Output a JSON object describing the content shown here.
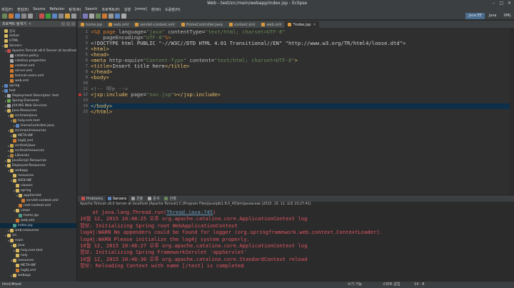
{
  "window": {
    "title": "Web - test/src/main/webapp/index.jsp - Eclipse"
  },
  "menu": [
    "파일(F)",
    "편집(E)",
    "Source",
    "Refactor",
    "탐색(N)",
    "Search",
    "프로젝트(P)",
    "실행",
    "[mme]",
    "창(W)",
    "도움말(H)"
  ],
  "perspectives": [
    "Java EE",
    "Java",
    "XML"
  ],
  "explorer": {
    "title": "프로젝트 탐색기",
    "items": [
      {
        "label": "장식",
        "depth": 0,
        "twisty": "",
        "kind": "folder"
      },
      {
        "label": "action",
        "depth": 0,
        "twisty": "",
        "kind": "folder"
      },
      {
        "label": "HTML",
        "depth": 0,
        "twisty": "",
        "kind": "folder"
      },
      {
        "label": "Servers",
        "depth": 0,
        "twisty": "▾",
        "kind": "folder"
      },
      {
        "label": "Apache Tomcat v8.0 Server at localhost",
        "depth": 1,
        "twisty": "▾",
        "kind": "server"
      },
      {
        "label": "catalina.policy",
        "depth": 2,
        "twisty": "",
        "kind": "file"
      },
      {
        "label": "catalina.properties",
        "depth": 2,
        "twisty": "",
        "kind": "file"
      },
      {
        "label": "context.xml",
        "depth": 2,
        "twisty": "",
        "kind": "xml"
      },
      {
        "label": "server.xml",
        "depth": 2,
        "twisty": "",
        "kind": "xml"
      },
      {
        "label": "tomcat-users.xml",
        "depth": 2,
        "twisty": "",
        "kind": "xml"
      },
      {
        "label": "web.xml",
        "depth": 2,
        "twisty": "",
        "kind": "xml"
      },
      {
        "label": "spring",
        "depth": 0,
        "twisty": "▸",
        "kind": "project"
      },
      {
        "label": "test",
        "depth": 0,
        "twisty": "▾",
        "kind": "project"
      },
      {
        "label": "Deployment Descriptor: test",
        "depth": 1,
        "twisty": "▸",
        "kind": "file"
      },
      {
        "label": "Spring Elements",
        "depth": 1,
        "twisty": "▸",
        "kind": "spring"
      },
      {
        "label": "JAX-WS Web Services",
        "depth": 1,
        "twisty": "▸",
        "kind": "file"
      },
      {
        "label": "Java Resources",
        "depth": 1,
        "twisty": "▾",
        "kind": "folder"
      },
      {
        "label": "src/main/java",
        "depth": 2,
        "twisty": "▾",
        "kind": "src"
      },
      {
        "label": "holy.com.test",
        "depth": 3,
        "twisty": "▾",
        "kind": "pkg"
      },
      {
        "label": "HomeController.java",
        "depth": 4,
        "twisty": "▸",
        "kind": "java"
      },
      {
        "label": "src/main/resources",
        "depth": 2,
        "twisty": "▾",
        "kind": "src"
      },
      {
        "label": "META-INF",
        "depth": 3,
        "twisty": "▸",
        "kind": "folder"
      },
      {
        "label": "log4j.xml",
        "depth": 3,
        "twisty": "",
        "kind": "xml"
      },
      {
        "label": "src/test/java",
        "depth": 2,
        "twisty": "▸",
        "kind": "src"
      },
      {
        "label": "src/test/resources",
        "depth": 2,
        "twisty": "▸",
        "kind": "src"
      },
      {
        "label": "Libraries",
        "depth": 2,
        "twisty": "▸",
        "kind": "lib"
      },
      {
        "label": "JavaScript Resources",
        "depth": 1,
        "twisty": "▸",
        "kind": "folder"
      },
      {
        "label": "Deployed Resources",
        "depth": 1,
        "twisty": "▾",
        "kind": "folder"
      },
      {
        "label": "webapp",
        "depth": 2,
        "twisty": "▾",
        "kind": "folder"
      },
      {
        "label": "resources",
        "depth": 3,
        "twisty": "",
        "kind": "folder"
      },
      {
        "label": "WEB-INF",
        "depth": 3,
        "twisty": "▾",
        "kind": "folder"
      },
      {
        "label": "classes",
        "depth": 4,
        "twisty": "",
        "kind": "folder"
      },
      {
        "label": "spring",
        "depth": 4,
        "twisty": "▾",
        "kind": "folder"
      },
      {
        "label": "appServlet",
        "depth": 5,
        "twisty": "▾",
        "kind": "folder"
      },
      {
        "label": "servlet-context.xml",
        "depth": 6,
        "twisty": "",
        "kind": "xml"
      },
      {
        "label": "root-context.xml",
        "depth": 5,
        "twisty": "",
        "kind": "xml"
      },
      {
        "label": "views",
        "depth": 4,
        "twisty": "▾",
        "kind": "folder"
      },
      {
        "label": "home.jsp",
        "depth": 5,
        "twisty": "",
        "kind": "jsp"
      },
      {
        "label": "web.xml",
        "depth": 4,
        "twisty": "",
        "kind": "xml"
      },
      {
        "label": "index.jsp",
        "depth": 3,
        "twisty": "",
        "kind": "jsp",
        "selected": true
      },
      {
        "label": "web-resources",
        "depth": 2,
        "twisty": "▸",
        "kind": "folder"
      },
      {
        "label": "src",
        "depth": 1,
        "twisty": "▾",
        "kind": "folder"
      },
      {
        "label": "main",
        "depth": 2,
        "twisty": "▾",
        "kind": "folder"
      },
      {
        "label": "java",
        "depth": 3,
        "twisty": "▾",
        "kind": "folder"
      },
      {
        "label": "holy.com.test",
        "depth": 4,
        "twisty": "▸",
        "kind": "folder"
      },
      {
        "label": "holy",
        "depth": 4,
        "twisty": "",
        "kind": "folder"
      },
      {
        "label": "resources",
        "depth": 3,
        "twisty": "▾",
        "kind": "folder"
      },
      {
        "label": "META-INF",
        "depth": 4,
        "twisty": "",
        "kind": "folder"
      },
      {
        "label": "log4j.xml",
        "depth": 4,
        "twisty": "",
        "kind": "xml"
      },
      {
        "label": "webapp",
        "depth": 3,
        "twisty": "▸",
        "kind": "folder"
      }
    ]
  },
  "editor": {
    "tabs": [
      {
        "label": "home.jsp",
        "active": false
      },
      {
        "label": "web.xml",
        "active": false
      },
      {
        "label": "servlet-context.xml",
        "active": false
      },
      {
        "label": "HomeController.java",
        "active": false
      },
      {
        "label": "context.xml",
        "active": false
      },
      {
        "label": "web.xml",
        "active": false
      },
      {
        "label": "*index.jsp",
        "active": true
      }
    ],
    "lines": [
      {
        "n": "1",
        "segs": [
          [
            "<%@ ",
            "#cc7832"
          ],
          [
            "page ",
            "#cc7832"
          ],
          [
            "language",
            "#bababa"
          ],
          [
            "=",
            "#ccc"
          ],
          [
            "\"java\"",
            "#6a8759"
          ],
          [
            " contentType",
            "#bababa"
          ],
          [
            "=",
            "#ccc"
          ],
          [
            "\"text/html; charset=UTF-8\"",
            "#6a8759"
          ]
        ]
      },
      {
        "n": "2",
        "segs": [
          [
            "    pageEncoding",
            "#bababa"
          ],
          [
            "=",
            "#ccc"
          ],
          [
            "\"UTF-8\"",
            "#6a8759"
          ],
          [
            "%>",
            "#cc7832"
          ]
        ]
      },
      {
        "n": "3",
        "segs": [
          [
            "<!DOCTYPE html PUBLIC \"-//W3C//DTD HTML 4.01 Transitional//EN\" \"http://www.w3.org/TR/html4/loose.dtd\">",
            "#d0d0d0"
          ]
        ]
      },
      {
        "n": "4",
        "segs": [
          [
            "<html>",
            "#e8bf6a"
          ]
        ]
      },
      {
        "n": "5",
        "segs": [
          [
            "<head>",
            "#e8bf6a"
          ]
        ]
      },
      {
        "n": "6",
        "segs": [
          [
            "<meta ",
            "#e8bf6a"
          ],
          [
            "http-equiv",
            "#bababa"
          ],
          [
            "=",
            "#ccc"
          ],
          [
            "\"Content-Type\"",
            "#6a8759"
          ],
          [
            " content",
            "#bababa"
          ],
          [
            "=",
            "#ccc"
          ],
          [
            "\"text/html; charset=UTF-8\"",
            "#6a8759"
          ],
          [
            ">",
            "#e8bf6a"
          ]
        ]
      },
      {
        "n": "7",
        "segs": [
          [
            "<title>",
            "#e8bf6a"
          ],
          [
            "Insert title here",
            "#d0d0d0"
          ],
          [
            "</title>",
            "#e8bf6a"
          ]
        ]
      },
      {
        "n": "8",
        "segs": [
          [
            "</head>",
            "#e8bf6a"
          ]
        ]
      },
      {
        "n": "9",
        "segs": [
          [
            "<body>",
            "#e8bf6a"
          ]
        ]
      },
      {
        "n": "10",
        "segs": []
      },
      {
        "n": "11",
        "segs": [
          [
            "<!-- 메뉴 -->",
            "#808080"
          ]
        ]
      },
      {
        "n": "12",
        "segs": [
          [
            "<jsp:include ",
            "#e8bf6a"
          ],
          [
            "page",
            "#bababa"
          ],
          [
            "=",
            "#ccc"
          ],
          [
            "\"nav.jsp\"",
            "#6a8759"
          ],
          [
            "></jsp:include>",
            "#e8bf6a"
          ]
        ]
      },
      {
        "n": "13",
        "segs": []
      },
      {
        "n": "14",
        "segs": [
          [
            "</body>",
            "#e8bf6a"
          ]
        ]
      },
      {
        "n": "15",
        "segs": [
          [
            "</html>",
            "#e8bf6a"
          ]
        ]
      }
    ]
  },
  "console": {
    "tabs": [
      "Problems",
      "Servers",
      "콘솔",
      "문서",
      "진행"
    ],
    "active_tab": 1,
    "info": "Apache Tomcat v8.0 Server at localhost [Apache Tomcat] C:\\Program Files\\Java\\jdk1.8.0_45\\bin\\javaw.exe (2015. 10. 12. 오후 10:27:41)",
    "lines": [
      {
        "segs": [
          [
            "    at java.lang.Thread.run(",
            "#e05561"
          ],
          [
            "Thread.java:745",
            "link"
          ],
          [
            ")",
            "#e05561"
          ]
        ]
      },
      {
        "segs": [
          [
            "10월 12, 2015 10:48:25 오후 org.apache.catalina.core.ApplicationContext log",
            "#e05561"
          ]
        ]
      },
      {
        "segs": [
          [
            "정보: Initializing Spring root WebApplicationContext",
            "#e05561"
          ]
        ]
      },
      {
        "segs": [
          [
            "log4j:WARN No appenders could be found for logger (org.springframework.web.context.ContextLoader).",
            "#e05561"
          ]
        ]
      },
      {
        "segs": [
          [
            "log4j:WARN Please initialize the log4j system properly.",
            "#e05561"
          ]
        ]
      },
      {
        "segs": [
          [
            "10월 12, 2015 10:48:27 오후 org.apache.catalina.core.ApplicationContext log",
            "#e05561"
          ]
        ]
      },
      {
        "segs": [
          [
            "정보: Initializing Spring FrameworkServlet 'appServlet'",
            "#e05561"
          ]
        ]
      },
      {
        "segs": [
          [
            "10월 12, 2015 10:48:30 오후 org.apache.catalina.core.StandardContext reload",
            "#e05561"
          ]
        ]
      },
      {
        "segs": [
          [
            "정보: Reloading Context with name [/test] is completed",
            "#e05561"
          ]
        ]
      }
    ]
  },
  "status": {
    "left": "html/#text",
    "mode": "쓰기 가능",
    "insert": "스마트 삽입",
    "position": "14 : 8"
  },
  "colors": {
    "accent": "#4a6c8e",
    "error": "#e05561",
    "selection": "#0d293e"
  }
}
